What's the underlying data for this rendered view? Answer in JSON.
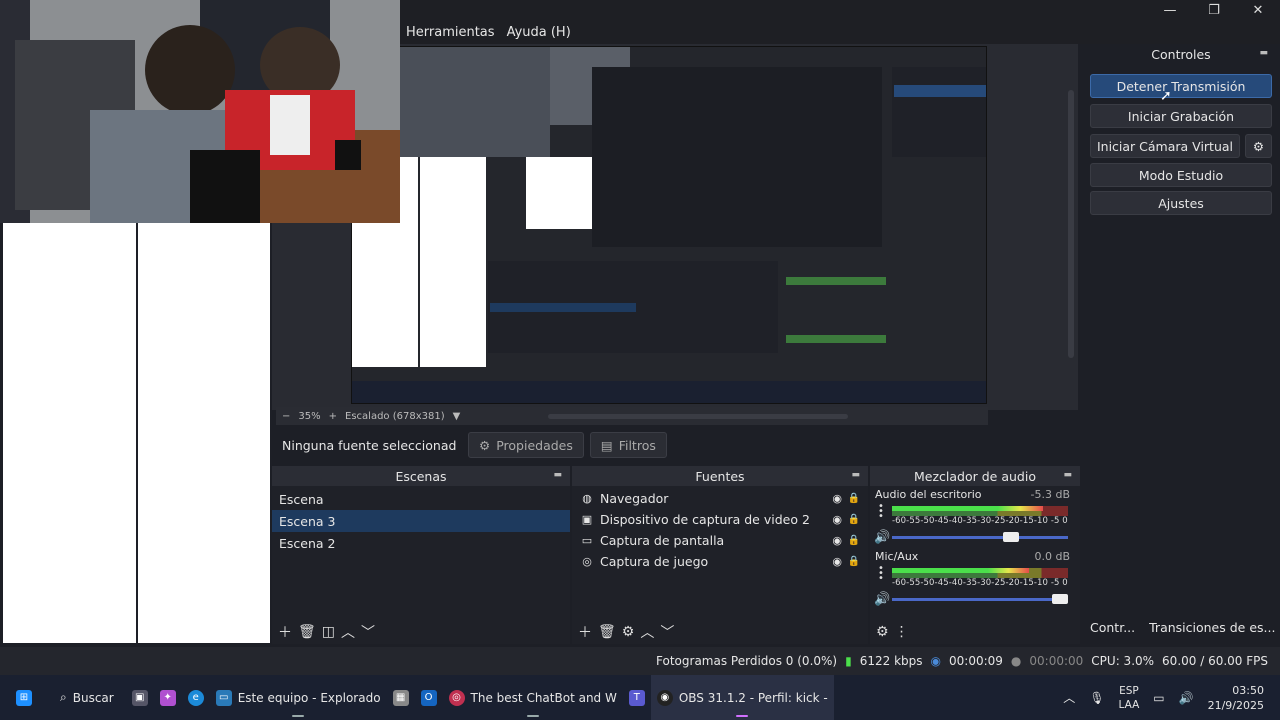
{
  "window": {
    "controls": {
      "minimize": "—",
      "maximize": "❐",
      "close": "✕"
    }
  },
  "menu": {
    "items": [
      "Herramientas",
      "Ayuda (H)"
    ]
  },
  "preview": {
    "zoom_minus": "−",
    "zoom": "35%",
    "zoom_plus": "+",
    "scaled": "Escalado (678x381)"
  },
  "properties_bar": {
    "no_source": "Ninguna fuente seleccionad",
    "properties": "Propiedades",
    "filters": "Filtros"
  },
  "scenes": {
    "title": "Escenas",
    "items": [
      {
        "label": "Escena",
        "selected": false
      },
      {
        "label": "Escena 3",
        "selected": true
      },
      {
        "label": "Escena 2",
        "selected": false
      }
    ]
  },
  "sources": {
    "title": "Fuentes",
    "items": [
      {
        "label": "Navegador",
        "icon": "globe-icon",
        "glyph": "◍"
      },
      {
        "label": "Dispositivo de captura de video 2",
        "icon": "camera-icon",
        "glyph": "▣"
      },
      {
        "label": "Captura de pantalla",
        "icon": "monitor-icon",
        "glyph": "▭"
      },
      {
        "label": "Captura de juego",
        "icon": "gamepad-icon",
        "glyph": "◎"
      }
    ]
  },
  "mixer": {
    "title": "Mezclador de audio",
    "channels": [
      {
        "name": "Audio del escritorio",
        "db": "-5.3 dB",
        "level": 0.86,
        "volume": 0.72
      },
      {
        "name": "Mic/Aux",
        "db": "0.0 dB",
        "level": 0.78,
        "volume": 1.0
      }
    ],
    "ticks": "-60-55-50-45-40-35-30-25-20-15-10 -5  0"
  },
  "controls": {
    "title": "Controles",
    "stop_stream": "Detener Transmisión",
    "start_recording": "Iniciar Grabación",
    "start_virtual_cam": "Iniciar Cámara Virtual",
    "studio_mode": "Modo Estudio",
    "settings": "Ajustes"
  },
  "bottom_tabs": {
    "controls_tab": "Contr...",
    "transitions_tab": "Transiciones de es..."
  },
  "status": {
    "dropped_frames": "Fotogramas Perdidos 0 (0.0%)",
    "bitrate": "6122 kbps",
    "stream_time": "00:00:09",
    "rec_time": "00:00:00",
    "cpu": "CPU: 3.0%",
    "fps": "60.00 / 60.00 FPS"
  },
  "taskbar": {
    "search": "Buscar",
    "explorer": "Este equipo - Explorado",
    "chatbot": "The best ChatBot and W",
    "obs": "OBS 31.1.2 - Perfil: kick -",
    "lang_top": "ESP",
    "lang_bottom": "LAA",
    "time": "03:50",
    "date": "21/9/2025"
  },
  "colors": {
    "accent": "#264a7a",
    "selected_scene": "#1e3a5e",
    "panel": "#1f2128",
    "volume_track": "#4a68c8"
  }
}
